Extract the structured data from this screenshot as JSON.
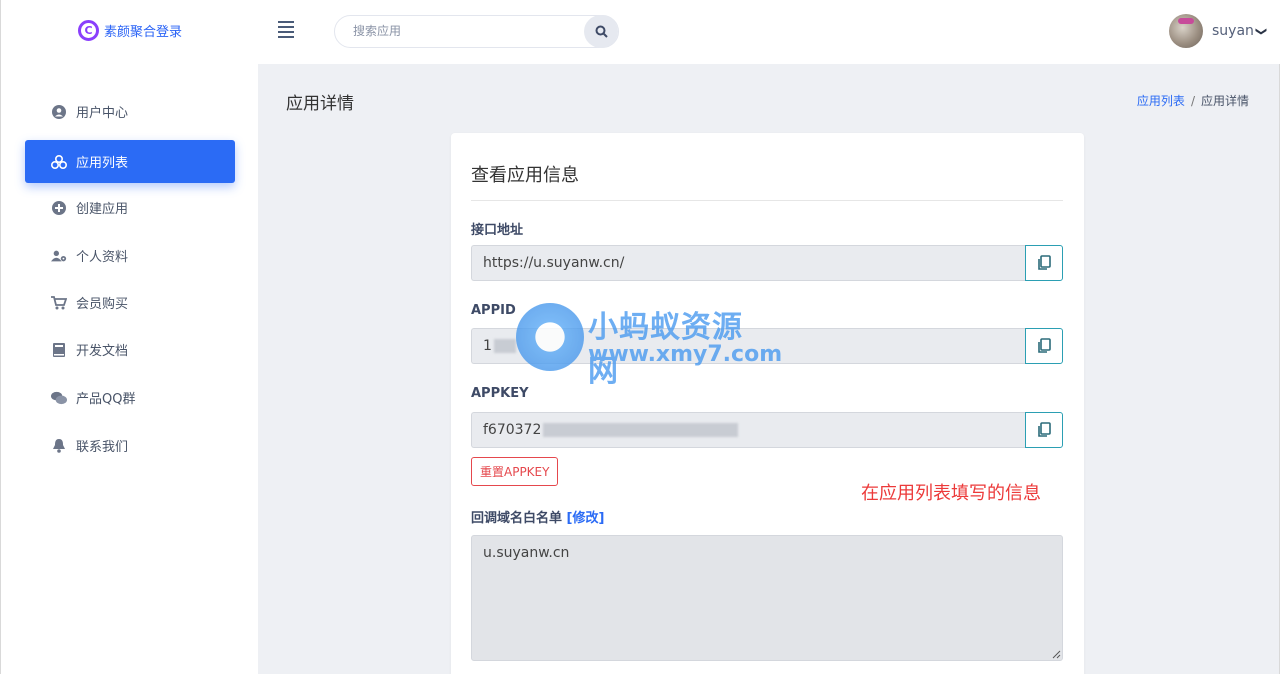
{
  "header": {
    "logo_glyph": "C",
    "logo_text": "素颜聚合登录",
    "search_placeholder": "搜索应用",
    "username": "suyan",
    "chevron": "❯"
  },
  "sidebar": {
    "items": [
      {
        "label": "用户中心",
        "icon": "user-circle-icon",
        "active": false
      },
      {
        "label": "应用列表",
        "icon": "cubes-icon",
        "active": true
      },
      {
        "label": "创建应用",
        "icon": "plus-circle-icon",
        "active": false
      },
      {
        "label": "个人资料",
        "icon": "user-gear-icon",
        "active": false
      },
      {
        "label": "会员购买",
        "icon": "cart-icon",
        "active": false
      },
      {
        "label": "开发文档",
        "icon": "book-icon",
        "active": false
      },
      {
        "label": "产品QQ群",
        "icon": "chat-icon",
        "active": false
      },
      {
        "label": "联系我们",
        "icon": "bell-icon",
        "active": false
      }
    ]
  },
  "main": {
    "page_title": "应用详情",
    "breadcrumb": {
      "parent": "应用列表",
      "separator": "/",
      "current": "应用详情"
    },
    "card": {
      "title": "查看应用信息",
      "api_label": "接口地址",
      "api_value": "https://u.suyanw.cn/",
      "appid_label": "APPID",
      "appid_value": "1",
      "appkey_label": "APPKEY",
      "appkey_value": "f670372",
      "reset_label": "重置APPKEY",
      "annotation": "在应用列表填写的信息",
      "callback_label": "回调域名白名单",
      "callback_edit": "[修改]",
      "callback_value": "u.suyanw.cn"
    }
  },
  "watermark": {
    "title": "小蚂蚁资源网",
    "url": "www.xmy7.com"
  },
  "colors": {
    "accent": "#2b6bf5",
    "danger": "#e5484d",
    "annotation": "#ec3a3a"
  }
}
